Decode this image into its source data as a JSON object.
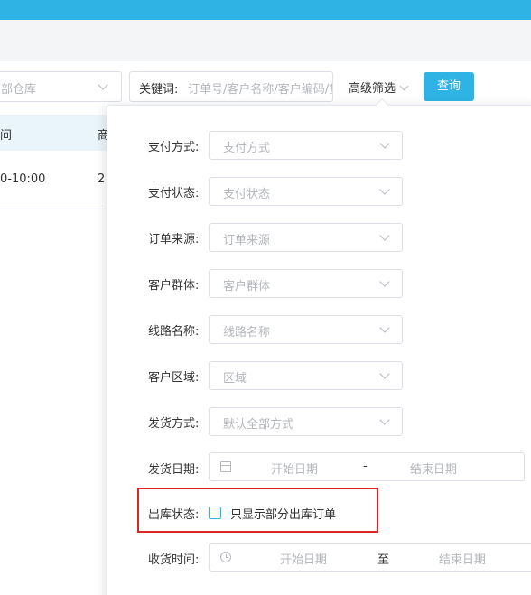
{
  "header": {
    "warehouse_select": {
      "placeholder": "部仓库"
    },
    "keyword": {
      "label": "关键词:",
      "placeholder": "订单号/客户名称/客户编码/货"
    },
    "advanced_filter_label": "高级筛选",
    "query_button": "查询"
  },
  "table": {
    "columns": [
      "间",
      "商"
    ],
    "rows": [
      [
        "0-10:00",
        "2"
      ]
    ]
  },
  "advanced_panel": {
    "fields": [
      {
        "label": "支付方式:",
        "placeholder": "支付方式"
      },
      {
        "label": "支付状态:",
        "placeholder": "支付状态"
      },
      {
        "label": "订单来源:",
        "placeholder": "订单来源"
      },
      {
        "label": "客户群体:",
        "placeholder": "客户群体"
      },
      {
        "label": "线路名称:",
        "placeholder": "线路名称"
      },
      {
        "label": "客户区域:",
        "placeholder": "区域"
      },
      {
        "label": "发货方式:",
        "placeholder": "默认全部方式"
      }
    ],
    "ship_date": {
      "label": "发货日期:",
      "start": "开始日期",
      "separator": "-",
      "end": "结束日期"
    },
    "stock_status": {
      "label": "出库状态:",
      "checkbox_label": "只显示部分出库订单",
      "checked": false
    },
    "receive_time": {
      "label": "收货时间:",
      "start": "开始日期",
      "separator": "至",
      "end": "结束日期"
    }
  },
  "colors": {
    "accent": "#2eb3e4",
    "highlight_border": "#e02424"
  }
}
